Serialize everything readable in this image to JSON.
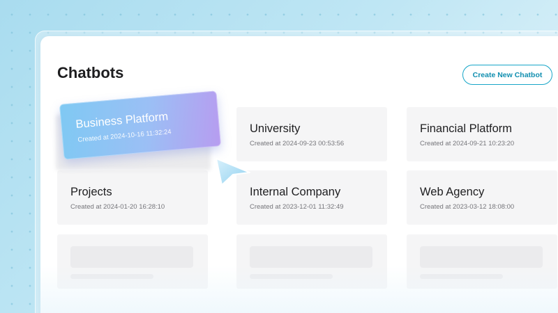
{
  "header": {
    "title": "Chatbots",
    "create_button": "Create New Chatbot"
  },
  "dragging_card": {
    "name": "Business Platform",
    "created": "Created at 2024-10-16 11:32:24"
  },
  "cards": [
    {
      "name": "University",
      "created": "Created at 2024-09-23 00:53:56"
    },
    {
      "name": "Financial Platform",
      "created": "Created at 2024-09-21 10:23:20"
    },
    {
      "name": "Projects",
      "created": "Created at 2024-01-20 16:28:10"
    },
    {
      "name": "Internal Company",
      "created": "Created at 2023-12-01 11:32:49"
    },
    {
      "name": "Web Agency",
      "created": "Created at 2023-03-12 18:08:00"
    }
  ],
  "colors": {
    "accent": "#17a6c8",
    "card_background": "#f5f5f6",
    "drag_gradient_start": "#7fc9f3",
    "drag_gradient_end": "#b79cf0"
  },
  "icons": {
    "pointer": "pointer-cursor-icon"
  }
}
